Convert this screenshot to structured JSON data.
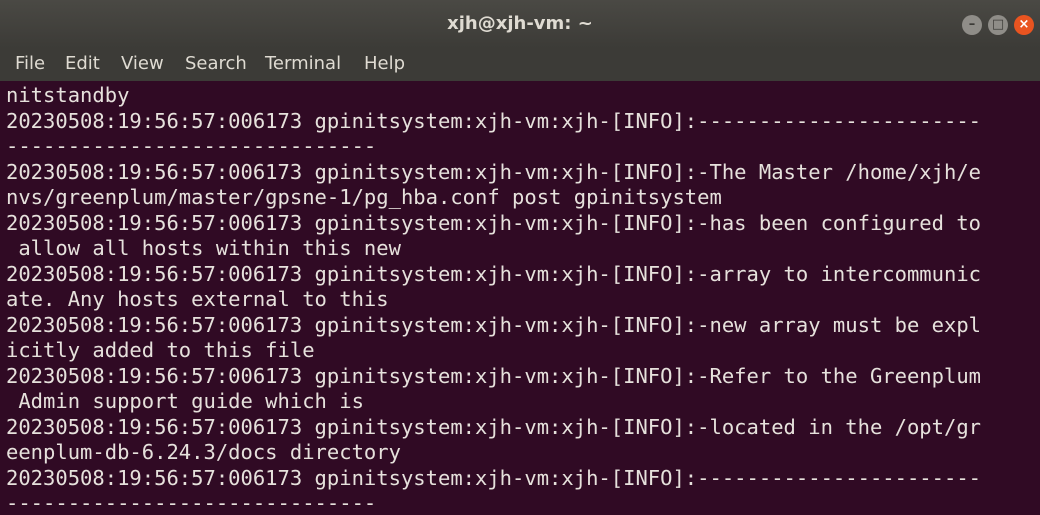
{
  "window": {
    "title": "xjh@xjh-vm: ~"
  },
  "controls": {
    "minimize_glyph": "–",
    "maximize_glyph": "□",
    "close_glyph": "×",
    "minimize_icon": "minimize-icon",
    "maximize_icon": "maximize-icon",
    "close_icon": "close-icon"
  },
  "menu": {
    "items": [
      "File",
      "Edit",
      "View",
      "Search",
      "Terminal",
      "Help"
    ]
  },
  "terminal": {
    "lines": [
      "nitstandby",
      "20230508:19:56:57:006173 gpinitsystem:xjh-vm:xjh-[INFO]:-----------------------",
      "------------------------------",
      "20230508:19:56:57:006173 gpinitsystem:xjh-vm:xjh-[INFO]:-The Master /home/xjh/e",
      "nvs/greenplum/master/gpsne-1/pg_hba.conf post gpinitsystem",
      "20230508:19:56:57:006173 gpinitsystem:xjh-vm:xjh-[INFO]:-has been configured to",
      " allow all hosts within this new",
      "20230508:19:56:57:006173 gpinitsystem:xjh-vm:xjh-[INFO]:-array to intercommunic",
      "ate. Any hosts external to this",
      "20230508:19:56:57:006173 gpinitsystem:xjh-vm:xjh-[INFO]:-new array must be expl",
      "icitly added to this file",
      "20230508:19:56:57:006173 gpinitsystem:xjh-vm:xjh-[INFO]:-Refer to the Greenplum",
      " Admin support guide which is",
      "20230508:19:56:57:006173 gpinitsystem:xjh-vm:xjh-[INFO]:-located in the /opt/gr",
      "eenplum-db-6.24.3/docs directory",
      "20230508:19:56:57:006173 gpinitsystem:xjh-vm:xjh-[INFO]:-----------------------",
      "------------------------------"
    ]
  },
  "colors": {
    "terminal_bg": "#300a24",
    "terminal_fg": "#e6e1dc",
    "chrome_bg": "#3c3b37",
    "close_button": "#e95420"
  }
}
